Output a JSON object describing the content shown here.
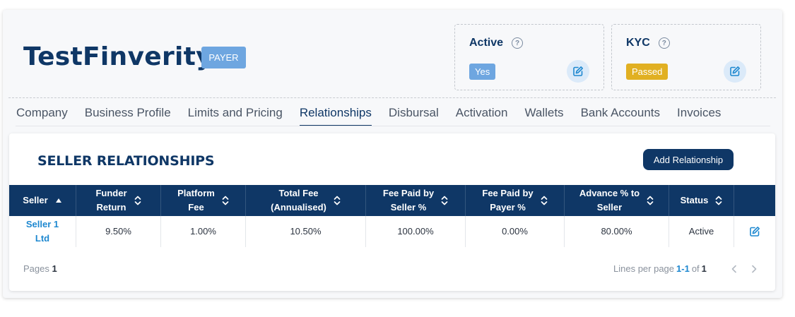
{
  "company": {
    "name": "TestFinverity",
    "role_badge": "PAYER"
  },
  "status_cards": {
    "active": {
      "title": "Active",
      "value": "Yes"
    },
    "kyc": {
      "title": "KYC",
      "value": "Passed"
    }
  },
  "tabs": [
    {
      "label": "Company"
    },
    {
      "label": "Business Profile"
    },
    {
      "label": "Limits and Pricing"
    },
    {
      "label": "Relationships",
      "active": true
    },
    {
      "label": "Disbursal"
    },
    {
      "label": "Activation"
    },
    {
      "label": "Wallets"
    },
    {
      "label": "Bank Accounts"
    },
    {
      "label": "Invoices"
    }
  ],
  "section": {
    "title": "SELLER RELATIONSHIPS",
    "add_button_label": "Add Relationship"
  },
  "table": {
    "columns": [
      {
        "line1": "Seller",
        "line2": "",
        "sort": "asc"
      },
      {
        "line1": "Funder",
        "line2": "Return",
        "sort": "both"
      },
      {
        "line1": "Platform",
        "line2": "Fee",
        "sort": "both"
      },
      {
        "line1": "Total Fee",
        "line2": "(Annualised)",
        "sort": "both"
      },
      {
        "line1": "Fee Paid by",
        "line2": "Seller %",
        "sort": "both"
      },
      {
        "line1": "Fee Paid by",
        "line2": "Payer %",
        "sort": "both"
      },
      {
        "line1": "Advance % to",
        "line2": "Seller",
        "sort": "both"
      },
      {
        "line1": "Status",
        "line2": "",
        "sort": "both"
      }
    ],
    "rows": [
      {
        "seller_line1": "Seller 1",
        "seller_line2": "Ltd",
        "funder_return": "9.50%",
        "platform_fee": "1.00%",
        "total_fee": "10.50%",
        "fee_paid_seller": "100.00%",
        "fee_paid_payer": "0.00%",
        "advance": "80.00%",
        "status": "Active"
      }
    ]
  },
  "footer": {
    "pages_label": "Pages",
    "pages_value": "1",
    "lines_label": "Lines per page",
    "range": "1-1",
    "of_label": "of",
    "total": "1"
  },
  "icons": {
    "help": "question-circle-icon",
    "edit": "edit-icon",
    "sort": "sort-icon",
    "prev": "chevron-left-icon",
    "next": "chevron-right-icon"
  },
  "colors": {
    "primary": "#0f3766",
    "badge_blue": "#6ea6e0",
    "badge_yellow": "#e1b022",
    "link_blue": "#1e88d0"
  }
}
